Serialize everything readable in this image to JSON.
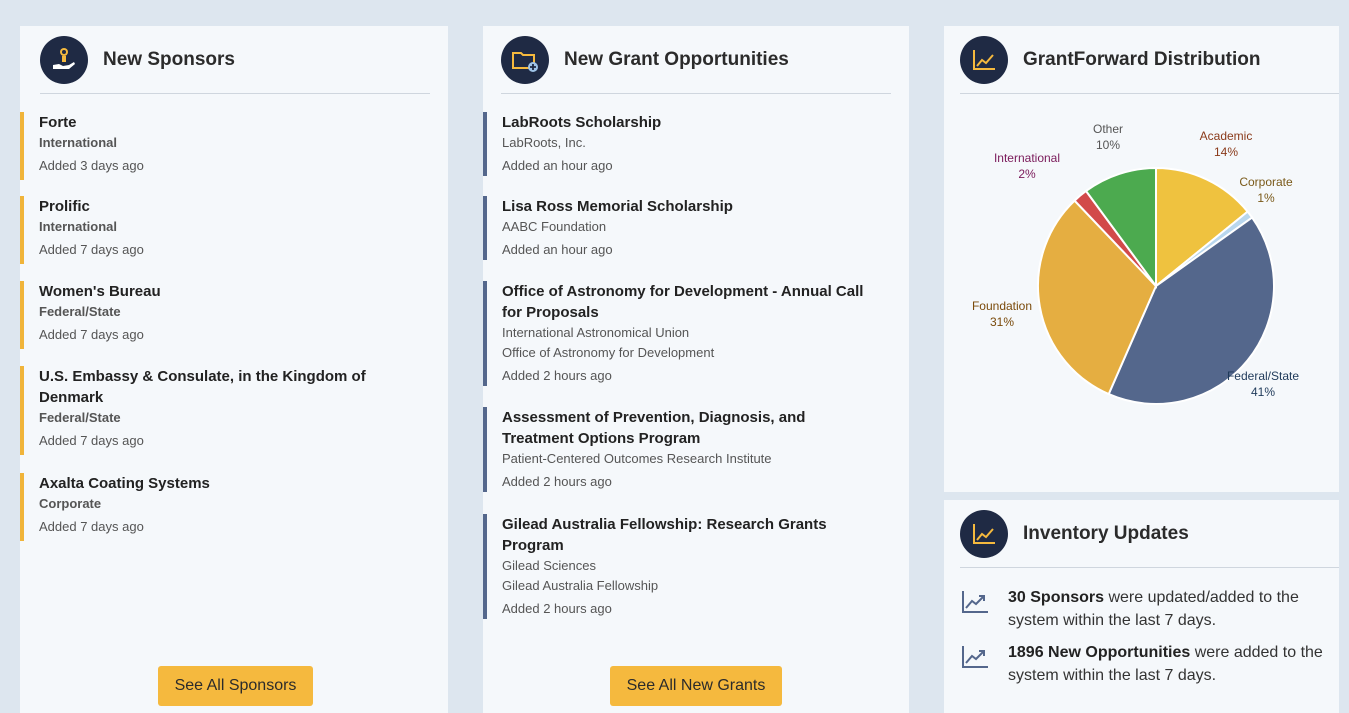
{
  "colors": {
    "sponsor_accent": "#f0b43a",
    "grant_accent": "#54678c",
    "button": "#f5b93e",
    "header_icon_bg": "#1f2a44"
  },
  "sponsors": {
    "title": "New Sponsors",
    "icon": "hand-award-icon",
    "items": [
      {
        "name": "Forte",
        "type": "International",
        "added": "Added 3 days ago"
      },
      {
        "name": "Prolific",
        "type": "International",
        "added": "Added 7 days ago"
      },
      {
        "name": "Women's Bureau",
        "type": "Federal/State",
        "added": "Added 7 days ago"
      },
      {
        "name": "U.S. Embassy & Consulate, in the Kingdom of Denmark",
        "type": "Federal/State",
        "added": "Added 7 days ago"
      },
      {
        "name": "Axalta Coating Systems",
        "type": "Corporate",
        "added": "Added 7 days ago"
      }
    ],
    "button": "See All Sponsors"
  },
  "grants": {
    "title": "New Grant Opportunities",
    "icon": "folder-plus-icon",
    "items": [
      {
        "title": "LabRoots Scholarship",
        "orgs": [
          "LabRoots, Inc."
        ],
        "added": "Added an hour ago"
      },
      {
        "title": "Lisa Ross Memorial Scholarship",
        "orgs": [
          "AABC Foundation"
        ],
        "added": "Added an hour ago"
      },
      {
        "title": "Office of Astronomy for Development - Annual Call for Proposals",
        "orgs": [
          "International Astronomical Union",
          "Office of Astronomy for Development"
        ],
        "added": "Added 2 hours ago"
      },
      {
        "title": "Assessment of Prevention, Diagnosis, and Treatment Options Program",
        "orgs": [
          "Patient-Centered Outcomes Research Institute"
        ],
        "added": "Added 2 hours ago"
      },
      {
        "title": "Gilead Australia Fellowship: Research Grants Program",
        "orgs": [
          "Gilead Sciences",
          "Gilead Australia Fellowship"
        ],
        "added": "Added 2 hours ago"
      }
    ],
    "button": "See All New Grants"
  },
  "distribution": {
    "title": "GrantForward Distribution",
    "icon": "line-chart-icon"
  },
  "chart_data": {
    "type": "pie",
    "title": "",
    "slices": [
      {
        "label": "Academic",
        "value": 14,
        "pct": "14%",
        "color": "#efc23f",
        "label_color": "#8a3a1a"
      },
      {
        "label": "Corporate",
        "value": 1,
        "pct": "1%",
        "color": "#b9d7ee",
        "label_color": "#7a5a1a"
      },
      {
        "label": "Federal/State",
        "value": 41,
        "pct": "41%",
        "color": "#54678c",
        "label_color": "#1f3a5a"
      },
      {
        "label": "Foundation",
        "value": 31,
        "pct": "31%",
        "color": "#e5ae41",
        "label_color": "#7a4a0a"
      },
      {
        "label": "International",
        "value": 2,
        "pct": "2%",
        "color": "#d24a4a",
        "label_color": "#7a1a5a"
      },
      {
        "label": "Other",
        "value": 10,
        "pct": "10%",
        "color": "#4caa4f",
        "label_color": "#555555"
      }
    ]
  },
  "inventory": {
    "title": "Inventory Updates",
    "icon": "line-chart-icon",
    "rows": [
      {
        "bold": "30 Sponsors",
        "text": " were updated/added to the system within the last 7 days.",
        "icon": "trend-up-icon"
      },
      {
        "bold": "1896 New Opportunities",
        "text": " were added to the system within the last 7 days.",
        "icon": "trend-up-icon"
      }
    ]
  }
}
